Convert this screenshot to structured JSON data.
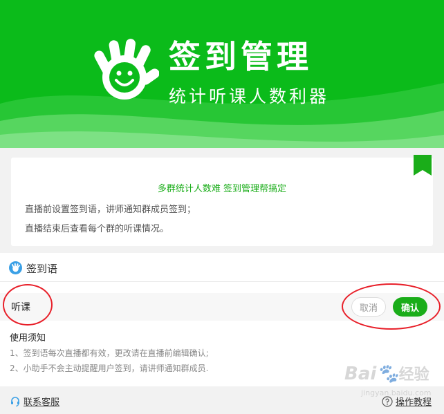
{
  "banner": {
    "title": "签到管理",
    "subtitle": "统计听课人数利器",
    "logo_icon": "smiling-hand-icon",
    "bg_color": "#0bbb1a"
  },
  "intro": {
    "slogan": "多群统计人数难 签到管理帮搞定",
    "line1": "直播前设置签到语，讲师通知群成员签到；",
    "line2": "直播结束后查看每个群的听课情况。",
    "bookmark_icon": "bookmark-icon"
  },
  "sign": {
    "title": "签到语",
    "icon": "hand-icon",
    "input_value": "听课",
    "cancel_label": "取消",
    "confirm_label": "确认",
    "accent_color": "#1aad19"
  },
  "notice": {
    "title": "使用须知",
    "items": [
      "1、签到语每次直播都有效，更改请在直播前编辑确认;",
      "2、小助手不会主动提醒用户签到，请讲师通知群成员."
    ]
  },
  "footer": {
    "contact_label": "联系客服",
    "contact_icon": "headset-icon",
    "tutorial_label": "操作教程",
    "tutorial_icon": "help-icon"
  },
  "watermark": {
    "brand": "Bai",
    "brand_cn": "经验",
    "sub": "jingyan.baidu.com"
  },
  "annotation_color": "#e8202a"
}
